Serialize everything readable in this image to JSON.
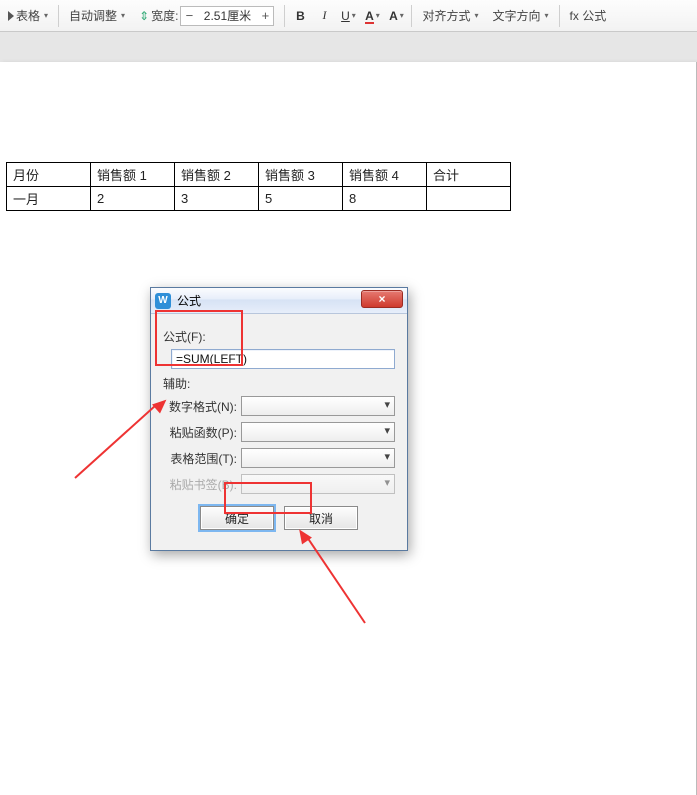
{
  "ribbon": {
    "table_btn": "表格",
    "auto_adjust": "自动调整",
    "width_label": "宽度:",
    "width_value": "2.51厘米",
    "height_sym": "⇕",
    "bold": "B",
    "italic": "I",
    "underline": "U",
    "fontcolor": "A",
    "highlight": "A",
    "align": "对齐方式",
    "text_dir": "文字方向",
    "formula": "fx 公式"
  },
  "table": {
    "headers": [
      "月份",
      "销售额 1",
      "销售额 2",
      "销售额 3",
      "销售额 4",
      "合计"
    ],
    "row1": [
      "一月",
      "2",
      "3",
      "5",
      "8",
      ""
    ]
  },
  "dialog": {
    "title": "公式",
    "app_glyph": "W",
    "close_glyph": "×",
    "formula_label": "公式(F):",
    "formula_value": "=SUM(LEFT)",
    "assist_label": "辅助:",
    "numfmt_label": "数字格式(N):",
    "pastefn_label": "粘贴函数(P):",
    "range_label": "表格范围(T):",
    "bookmark_label": "粘贴书签(B):",
    "ok": "确定",
    "cancel": "取消"
  }
}
